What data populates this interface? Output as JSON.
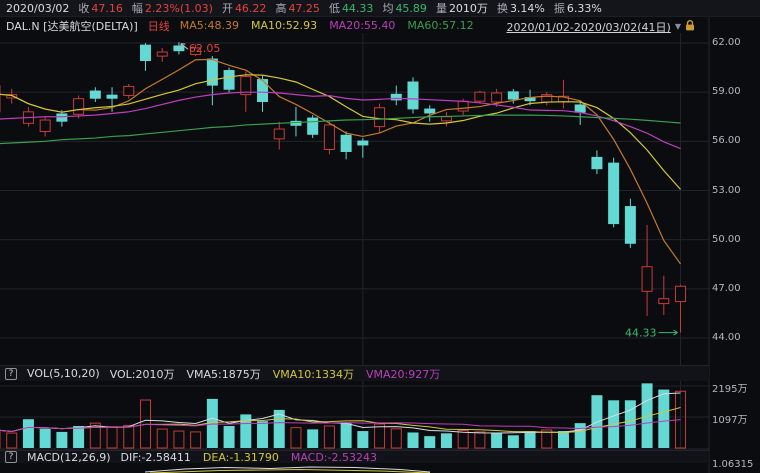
{
  "header": {
    "date": "2020/03/02",
    "stats": [
      {
        "label": "收",
        "value": "47.16",
        "color": "#e0433e"
      },
      {
        "label": "幅",
        "value": "2.23%(1.03)",
        "color": "#e0433e"
      },
      {
        "label": "开",
        "value": "46.22",
        "color": "#e0433e"
      },
      {
        "label": "高",
        "value": "47.25",
        "color": "#e0433e"
      },
      {
        "label": "低",
        "value": "44.33",
        "color": "#36b96d"
      },
      {
        "label": "均",
        "value": "45.89",
        "color": "#36b96d"
      },
      {
        "label": "量",
        "value": "2010万",
        "color": "#d9dbe0"
      },
      {
        "label": "换",
        "value": "3.14%",
        "color": "#d9dbe0"
      },
      {
        "label": "振",
        "value": "6.33%",
        "color": "#d9dbe0"
      }
    ]
  },
  "legend": {
    "symbol": "DAL.N",
    "name": "[达美航空(DELTA)]",
    "period": "日线",
    "mas": [
      {
        "label": "MA5:48.39",
        "color": "#c47a2e"
      },
      {
        "label": "MA10:52.93",
        "color": "#d3c73b"
      },
      {
        "label": "MA20:55.40",
        "color": "#bb3fbb"
      },
      {
        "label": "MA60:57.12",
        "color": "#3a9e4f"
      }
    ],
    "range": "2020/01/02-2020/03/02(41日)"
  },
  "vol_header": {
    "help": "?",
    "title": "VOL(5,10,20)",
    "items": [
      {
        "label": "VOL:2010万",
        "color": "#d9dbe0"
      },
      {
        "label": "VMA5:1875万",
        "color": "#d9dbe0"
      },
      {
        "label": "VMA10:1334万",
        "color": "#d3c73b"
      },
      {
        "label": "VMA20:927万",
        "color": "#bb3fbb"
      }
    ]
  },
  "macd_header": {
    "help": "?",
    "title": "MACD(12,26,9)",
    "items": [
      {
        "label": "DIF:-2.58411",
        "color": "#d9dbe0"
      },
      {
        "label": "DEA:-1.31790",
        "color": "#d3c73b"
      },
      {
        "label": "MACD:-2.53243",
        "color": "#bb3fbb"
      }
    ]
  },
  "axes": {
    "price": [
      "62.00",
      "59.00",
      "56.00",
      "53.00",
      "50.00",
      "47.00",
      "44.00"
    ],
    "volume": [
      "2195万",
      "1097万"
    ],
    "macd": [
      "1.06315"
    ]
  },
  "colors": {
    "up": "#c93a38",
    "down": "#64d8d2",
    "ma5": "#c47a2e",
    "ma10": "#d3c73b",
    "ma20": "#bb3fbb",
    "ma60": "#3a9e4f",
    "vma5": "#d9dbe0",
    "vma10": "#d3c73b",
    "vma20": "#bb3fbb",
    "grid": "#22242b",
    "border": "#262933",
    "ann_red": "#e0433e",
    "ann_green": "#36b96d"
  },
  "chart_data": {
    "type": "candlestick+volume",
    "symbol": "DAL.N",
    "period_label": "日线",
    "range_label": "2020/01/02-2020/03/02(41日)",
    "sessions": 41,
    "price_ticks": [
      62,
      59,
      56,
      53,
      50,
      47,
      44
    ],
    "price_ylim": [
      42.5,
      62.6
    ],
    "volume_ticks_wan": [
      2195,
      1097
    ],
    "volume_ylim_wan": [
      0,
      2360
    ],
    "candles": [
      {
        "o": 57.8,
        "h": 59.5,
        "l": 57.6,
        "c": 59.4,
        "d": "u",
        "v": 640,
        "vd": "u"
      },
      {
        "o": 58.65,
        "h": 59.2,
        "l": 58.3,
        "c": 58.85,
        "d": "u",
        "v": 530,
        "vd": "u"
      },
      {
        "o": 57.1,
        "h": 58.1,
        "l": 56.9,
        "c": 57.8,
        "d": "u",
        "v": 1020,
        "vd": "d"
      },
      {
        "o": 56.6,
        "h": 57.5,
        "l": 56.3,
        "c": 57.3,
        "d": "u",
        "v": 680,
        "vd": "d"
      },
      {
        "o": 57.7,
        "h": 57.9,
        "l": 56.9,
        "c": 57.2,
        "d": "d",
        "v": 570,
        "vd": "d"
      },
      {
        "o": 57.65,
        "h": 58.8,
        "l": 57.4,
        "c": 58.6,
        "d": "u",
        "v": 780,
        "vd": "d"
      },
      {
        "o": 59.1,
        "h": 59.3,
        "l": 58.4,
        "c": 58.6,
        "d": "d",
        "v": 880,
        "vd": "u"
      },
      {
        "o": 58.85,
        "h": 59.3,
        "l": 57.8,
        "c": 58.6,
        "d": "d",
        "v": 750,
        "vd": "u"
      },
      {
        "o": 58.8,
        "h": 59.5,
        "l": 58.6,
        "c": 59.35,
        "d": "u",
        "v": 800,
        "vd": "u"
      },
      {
        "o": 61.9,
        "h": 62.0,
        "l": 60.3,
        "c": 60.9,
        "d": "d",
        "v": 1700,
        "vd": "u"
      },
      {
        "o": 61.2,
        "h": 61.7,
        "l": 60.85,
        "c": 61.45,
        "d": "u",
        "v": 670,
        "vd": "u"
      },
      {
        "o": 61.85,
        "h": 62.05,
        "l": 61.3,
        "c": 61.5,
        "d": "d",
        "v": 600,
        "vd": "u"
      },
      {
        "o": 61.3,
        "h": 61.9,
        "l": 61.2,
        "c": 61.7,
        "d": "u",
        "v": 570,
        "vd": "u"
      },
      {
        "o": 61.05,
        "h": 61.2,
        "l": 58.2,
        "c": 59.4,
        "d": "d",
        "v": 1740,
        "vd": "d"
      },
      {
        "o": 60.35,
        "h": 60.5,
        "l": 59.0,
        "c": 59.15,
        "d": "d",
        "v": 780,
        "vd": "d"
      },
      {
        "o": 58.85,
        "h": 60.25,
        "l": 57.8,
        "c": 59.95,
        "d": "u",
        "v": 1190,
        "vd": "d"
      },
      {
        "o": 59.8,
        "h": 60.0,
        "l": 57.8,
        "c": 58.4,
        "d": "d",
        "v": 950,
        "vd": "d"
      },
      {
        "o": 56.15,
        "h": 57.2,
        "l": 55.5,
        "c": 56.75,
        "d": "u",
        "v": 1350,
        "vd": "d"
      },
      {
        "o": 57.25,
        "h": 58.1,
        "l": 56.3,
        "c": 56.95,
        "d": "d",
        "v": 720,
        "vd": "u"
      },
      {
        "o": 57.45,
        "h": 57.6,
        "l": 56.2,
        "c": 56.4,
        "d": "d",
        "v": 660,
        "vd": "d"
      },
      {
        "o": 55.5,
        "h": 57.2,
        "l": 55.2,
        "c": 57.0,
        "d": "u",
        "v": 780,
        "vd": "u"
      },
      {
        "o": 56.4,
        "h": 56.6,
        "l": 54.9,
        "c": 55.35,
        "d": "d",
        "v": 880,
        "vd": "d"
      },
      {
        "o": 56.05,
        "h": 56.2,
        "l": 55.0,
        "c": 55.75,
        "d": "d",
        "v": 600,
        "vd": "d"
      },
      {
        "o": 56.9,
        "h": 58.3,
        "l": 56.5,
        "c": 58.05,
        "d": "u",
        "v": 850,
        "vd": "u"
      },
      {
        "o": 58.9,
        "h": 59.4,
        "l": 58.2,
        "c": 58.5,
        "d": "d",
        "v": 680,
        "vd": "u"
      },
      {
        "o": 59.65,
        "h": 59.9,
        "l": 57.7,
        "c": 57.95,
        "d": "d",
        "v": 550,
        "vd": "d"
      },
      {
        "o": 58.0,
        "h": 58.2,
        "l": 57.2,
        "c": 57.7,
        "d": "d",
        "v": 420,
        "vd": "d"
      },
      {
        "o": 57.25,
        "h": 57.8,
        "l": 56.9,
        "c": 57.5,
        "d": "u",
        "v": 520,
        "vd": "d"
      },
      {
        "o": 57.85,
        "h": 58.6,
        "l": 57.6,
        "c": 58.45,
        "d": "u",
        "v": 620,
        "vd": "u"
      },
      {
        "o": 58.45,
        "h": 59.1,
        "l": 58.3,
        "c": 59.0,
        "d": "u",
        "v": 570,
        "vd": "u"
      },
      {
        "o": 58.4,
        "h": 59.2,
        "l": 58.1,
        "c": 58.95,
        "d": "u",
        "v": 530,
        "vd": "d"
      },
      {
        "o": 59.05,
        "h": 59.2,
        "l": 58.3,
        "c": 58.55,
        "d": "d",
        "v": 450,
        "vd": "d"
      },
      {
        "o": 58.7,
        "h": 59.15,
        "l": 58.2,
        "c": 58.45,
        "d": "d",
        "v": 600,
        "vd": "d"
      },
      {
        "o": 58.4,
        "h": 59.0,
        "l": 58.2,
        "c": 58.85,
        "d": "u",
        "v": 640,
        "vd": "u"
      },
      {
        "o": 58.4,
        "h": 59.75,
        "l": 58.0,
        "c": 58.75,
        "d": "u",
        "v": 600,
        "vd": "d"
      },
      {
        "o": 58.25,
        "h": 58.4,
        "l": 57.0,
        "c": 57.75,
        "d": "d",
        "v": 880,
        "vd": "d"
      },
      {
        "o": 55.05,
        "h": 55.45,
        "l": 54.0,
        "c": 54.3,
        "d": "d",
        "v": 1870,
        "vd": "d"
      },
      {
        "o": 54.7,
        "h": 55.0,
        "l": 50.75,
        "c": 50.95,
        "d": "d",
        "v": 1690,
        "vd": "d"
      },
      {
        "o": 52.05,
        "h": 52.5,
        "l": 49.5,
        "c": 49.75,
        "d": "d",
        "v": 1690,
        "vd": "d"
      },
      {
        "o": 46.85,
        "h": 50.9,
        "l": 45.35,
        "c": 48.35,
        "d": "u",
        "v": 2290,
        "vd": "d"
      },
      {
        "o": 46.1,
        "h": 47.8,
        "l": 45.4,
        "c": 46.4,
        "d": "u",
        "v": 2070,
        "vd": "d"
      },
      {
        "o": 46.22,
        "h": 47.25,
        "l": 44.33,
        "c": 47.16,
        "d": "u",
        "v": 2010,
        "vd": "u"
      }
    ],
    "ma": {
      "ma5": [
        58.9,
        58.8,
        58.3,
        57.97,
        57.78,
        57.94,
        57.9,
        58.06,
        58.47,
        59.21,
        59.78,
        60.36,
        60.98,
        60.99,
        60.64,
        60.34,
        59.72,
        58.73,
        58.25,
        57.7,
        57.11,
        56.5,
        56.3,
        56.51,
        56.93,
        57.12,
        57.59,
        57.94,
        58.02,
        58.12,
        58.32,
        58.49,
        58.68,
        58.76,
        58.71,
        58.47,
        57.62,
        56.12,
        54.3,
        52.22,
        49.95,
        48.52
      ],
      "ma10": [
        58.9,
        58.8,
        58.3,
        57.97,
        57.78,
        57.94,
        58.05,
        58.13,
        58.28,
        58.57,
        58.86,
        59.13,
        59.52,
        59.73,
        59.93,
        60.06,
        60.04,
        59.86,
        59.62,
        59.17,
        58.73,
        58.11,
        57.52,
        57.38,
        57.32,
        57.12,
        57.05,
        57.12,
        57.27,
        57.53,
        57.72,
        58.04,
        58.31,
        58.39,
        58.42,
        58.4,
        58.06,
        57.4,
        56.53,
        55.47,
        54.21,
        53.07
      ],
      "ma20": [
        57.35,
        57.4,
        57.45,
        57.5,
        57.5,
        57.55,
        57.6,
        57.7,
        57.8,
        58.0,
        58.25,
        58.5,
        58.7,
        58.85,
        58.95,
        59.0,
        59.0,
        58.95,
        58.85,
        58.75,
        58.79,
        58.62,
        58.52,
        58.56,
        58.62,
        58.59,
        58.54,
        58.49,
        58.44,
        58.35,
        58.22,
        58.08,
        57.91,
        57.89,
        57.87,
        57.76,
        57.55,
        57.26,
        56.9,
        56.5,
        55.97,
        55.56
      ],
      "ma60": [
        55.85,
        55.9,
        55.95,
        56.0,
        56.1,
        56.15,
        56.2,
        56.3,
        56.35,
        56.45,
        56.55,
        56.65,
        56.75,
        56.85,
        56.9,
        57.0,
        57.05,
        57.1,
        57.15,
        57.2,
        57.25,
        57.3,
        57.32,
        57.35,
        57.4,
        57.45,
        57.5,
        57.52,
        57.55,
        57.58,
        57.6,
        57.6,
        57.6,
        57.58,
        57.55,
        57.5,
        57.45,
        57.4,
        57.35,
        57.28,
        57.2,
        57.12
      ]
    },
    "annotations": {
      "period_high_label": "62.05",
      "period_high_day": 11,
      "period_low_label": "44.33",
      "period_low_day": 41
    },
    "vgrid_days": [
      22,
      41
    ]
  }
}
